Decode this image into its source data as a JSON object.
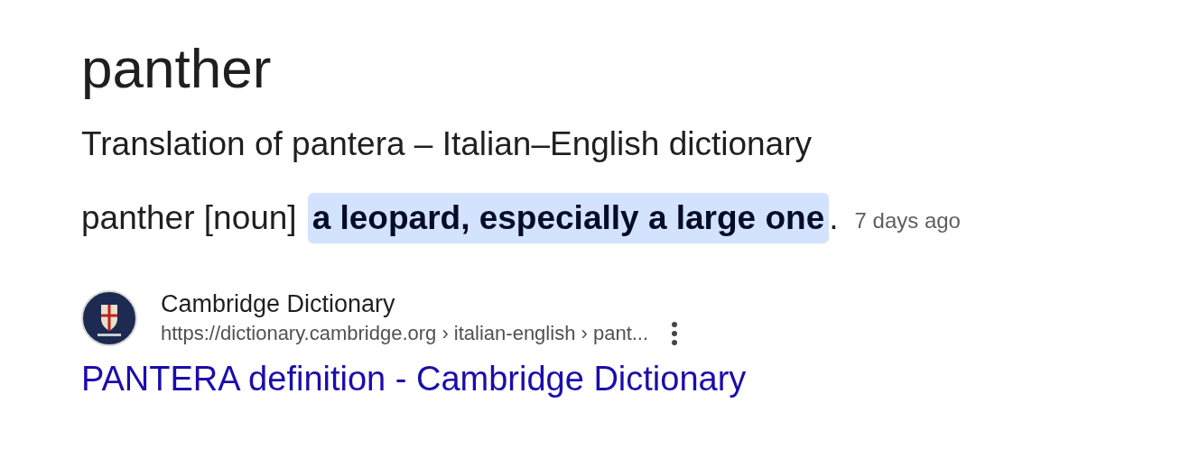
{
  "heading": "panther",
  "snippet": {
    "source_line": "Translation of pantera – Italian–English dictionary",
    "prefix": "panther [noun]",
    "highlight": "a leopard, especially a large one",
    "suffix": ".",
    "date": "7 days ago"
  },
  "result": {
    "site_name": "Cambridge Dictionary",
    "url": "https://dictionary.cambridge.org › italian-english › pant...",
    "title": "PANTERA definition - Cambridge Dictionary"
  }
}
